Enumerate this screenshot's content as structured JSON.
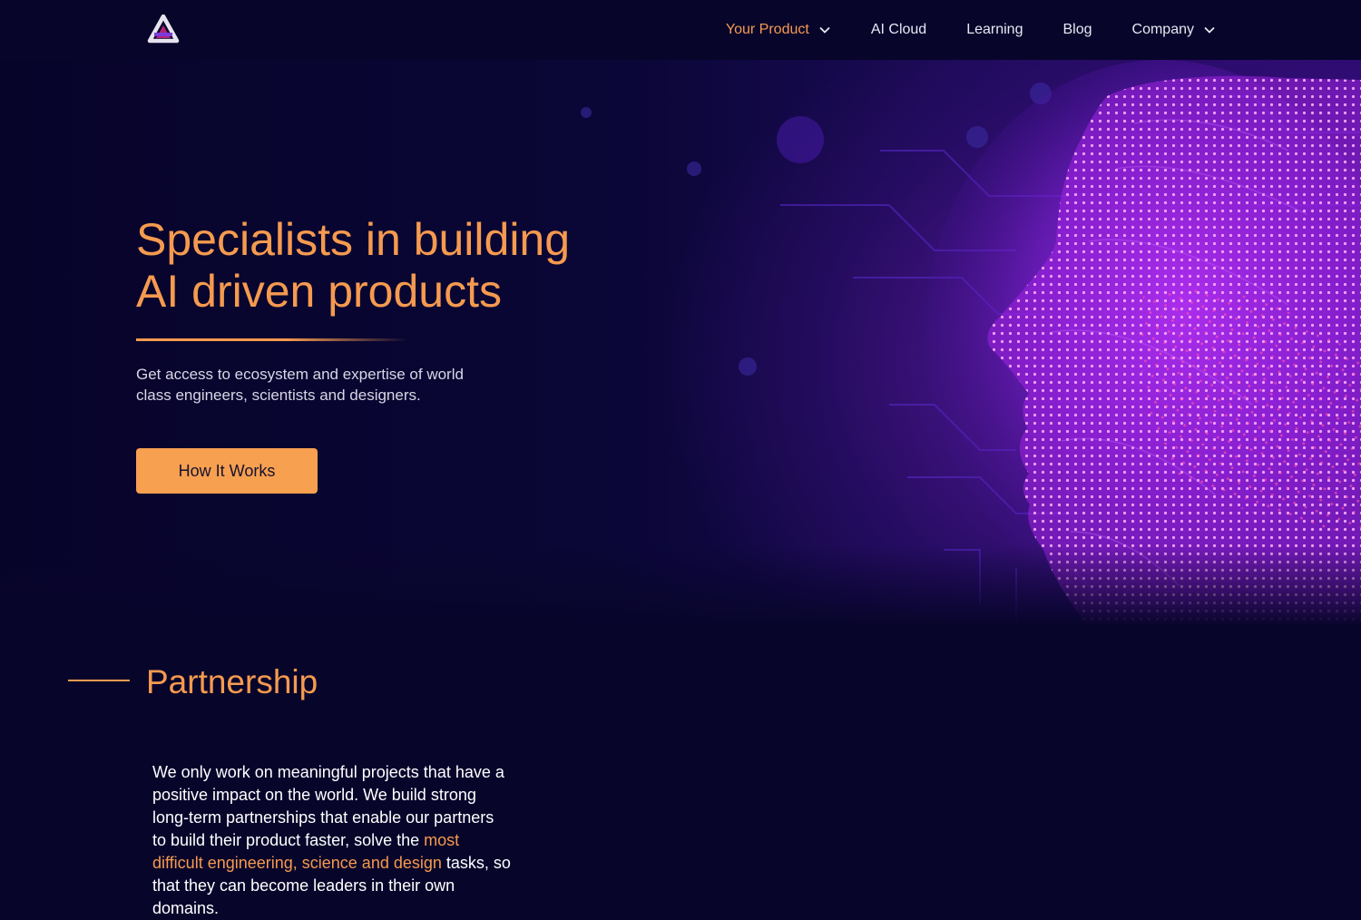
{
  "header": {
    "logo_name": "brand-logo",
    "nav": [
      {
        "label": "Your Product",
        "has_dropdown": true,
        "active": true
      },
      {
        "label": "AI Cloud",
        "has_dropdown": false,
        "active": false
      },
      {
        "label": "Learning",
        "has_dropdown": false,
        "active": false
      },
      {
        "label": "Blog",
        "has_dropdown": false,
        "active": false
      },
      {
        "label": "Company",
        "has_dropdown": true,
        "active": false
      }
    ]
  },
  "hero": {
    "title_line1": "Specialists in building",
    "title_line2": "AI driven products",
    "subtitle": "Get access to ecosystem and expertise of world class engineers, scientists and designers.",
    "cta_label": "How It Works",
    "image_icon": "ai-face-illustration"
  },
  "partnership": {
    "title": "Partnership",
    "body_before": "We only work on meaningful projects that have a positive impact on the world. We build strong long-term partnerships that enable our partners to build their product faster, solve the ",
    "body_highlight": "most difficult engineering, science and design",
    "body_after": " tasks, so that they can become leaders in their own domains."
  },
  "colors": {
    "background": "#08052b",
    "accent": "#f59a4f",
    "button": "#f7a050",
    "glow": "#9a2bdc"
  }
}
